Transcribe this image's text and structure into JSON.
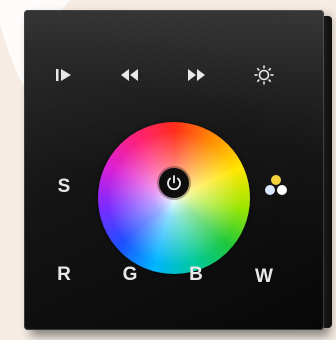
{
  "panel": {
    "buttons": {
      "s_label": "S",
      "r_label": "R",
      "g_label": "G",
      "b_label": "B",
      "w_label": "W"
    },
    "icons": [
      "play-pause-icon",
      "rewind-icon",
      "fast-forward-icon",
      "brightness-icon",
      "power-icon",
      "color-temperature-icon"
    ],
    "colors": {
      "panel": "#111111",
      "keys": "#e8e8e8",
      "background": "#f6ece3",
      "dot_warm": "#f5d23a",
      "dot_cool": "#d9e7ff",
      "dot_white": "#ffffff"
    }
  }
}
